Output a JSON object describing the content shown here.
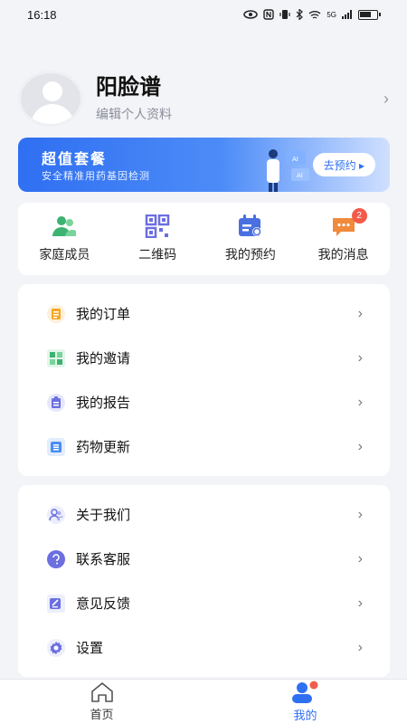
{
  "status_bar": {
    "time": "16:18",
    "signal_text": "5G"
  },
  "profile": {
    "name": "阳脸谱",
    "subtitle": "编辑个人资料"
  },
  "banner": {
    "title": "超值套餐",
    "subtitle": "安全精准用药基因检测",
    "button_label": "去预约 ▸"
  },
  "quick_actions": [
    {
      "label": "家庭成员",
      "icon": "family-members-icon"
    },
    {
      "label": "二维码",
      "icon": "qr-code-icon"
    },
    {
      "label": "我的预约",
      "icon": "calendar-icon"
    },
    {
      "label": "我的消息",
      "icon": "message-icon",
      "badge": "2"
    }
  ],
  "menu_group_1": [
    {
      "label": "我的订单",
      "icon": "order-icon",
      "color": "#f5a623"
    },
    {
      "label": "我的邀请",
      "icon": "invite-icon",
      "color": "#3cb371"
    },
    {
      "label": "我的报告",
      "icon": "report-icon",
      "color": "#6b6fe0"
    },
    {
      "label": "药物更新",
      "icon": "drug-update-icon",
      "color": "#4a8df2"
    }
  ],
  "menu_group_2": [
    {
      "label": "关于我们",
      "icon": "about-icon",
      "color": "#6b6fe0"
    },
    {
      "label": "联系客服",
      "icon": "customer-service-icon",
      "color": "#6b6fe0"
    },
    {
      "label": "意见反馈",
      "icon": "feedback-icon",
      "color": "#6b6fe0"
    },
    {
      "label": "设置",
      "icon": "settings-icon",
      "color": "#6b6fe0"
    }
  ],
  "tabbar": [
    {
      "label": "首页",
      "active": false
    },
    {
      "label": "我的",
      "active": true
    }
  ],
  "colors": {
    "accent": "#2f6ff2",
    "badge": "#f25b4b",
    "background": "#f3f4f8"
  }
}
